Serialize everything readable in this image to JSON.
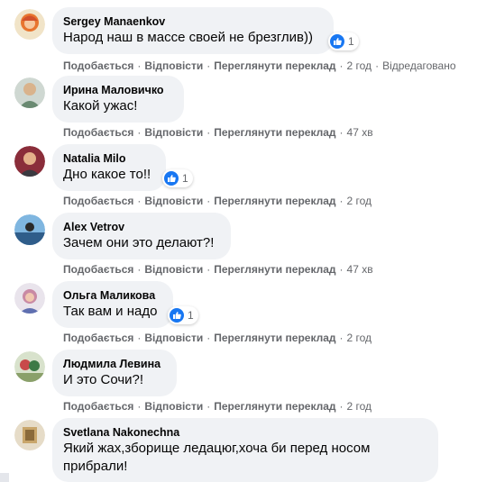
{
  "comments": [
    {
      "author": "Sergey Manaenkov",
      "text": "Народ наш в массе своей не брезглив))",
      "reaction_count": "1",
      "like": "Подобається",
      "reply": "Відповісти",
      "translate": "Переглянути переклад",
      "time": "2 год",
      "edited": "Відредаговано"
    },
    {
      "author": "Ирина Маловичко",
      "text": "Какой ужас!",
      "like": "Подобається",
      "reply": "Відповісти",
      "translate": "Переглянути переклад",
      "time": "47 хв"
    },
    {
      "author": "Natalia Milo",
      "text": "Дно какое то!!",
      "reaction_count": "1",
      "like": "Подобається",
      "reply": "Відповісти",
      "translate": "Переглянути переклад",
      "time": "2 год"
    },
    {
      "author": "Alex Vetrov",
      "text": "Зачем они это делают?!",
      "like": "Подобається",
      "reply": "Відповісти",
      "translate": "Переглянути переклад",
      "time": "47 хв"
    },
    {
      "author": "Ольга Маликова",
      "text": "Так вам и надо",
      "reaction_count": "1",
      "like": "Подобається",
      "reply": "Відповісти",
      "translate": "Переглянути переклад",
      "time": "2 год"
    },
    {
      "author": "Людмила Левина",
      "text": "И это Сочи?!",
      "like": "Подобається",
      "reply": "Відповісти",
      "translate": "Переглянути переклад",
      "time": "2 год"
    },
    {
      "author": "Svetlana Nakonechna",
      "text_line1": "Який жах,зборище ледацюг,хоча би перед носом",
      "text_line2": "прибрали!"
    }
  ],
  "colors": {
    "bubble": "#f0f2f5",
    "secondary_text": "#65676b",
    "like_blue": "#1877f2"
  },
  "icons": [
    "like-icon"
  ]
}
